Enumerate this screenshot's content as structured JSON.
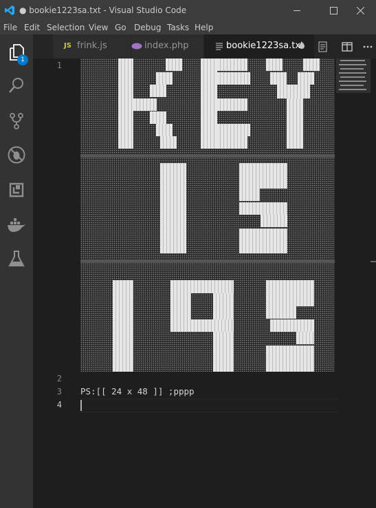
{
  "window": {
    "title": "● bookie1223sa.txt - Visual Studio Code",
    "controls": {
      "minimize": "minimize-icon",
      "maximize": "maximize-icon",
      "close": "close-icon"
    }
  },
  "menu": {
    "items": [
      "File",
      "Edit",
      "Selection",
      "View",
      "Go",
      "Debug",
      "Tasks",
      "Help"
    ]
  },
  "activity": {
    "items": [
      {
        "icon": "explorer-icon",
        "badge": "1"
      },
      {
        "icon": "search-icon"
      },
      {
        "icon": "source-control-icon"
      },
      {
        "icon": "debug-icon"
      },
      {
        "icon": "extensions-icon"
      },
      {
        "icon": "docker-icon"
      },
      {
        "icon": "flask-icon"
      }
    ]
  },
  "tabs": [
    {
      "prefix": "JS",
      "label": "frink.js",
      "active": false
    },
    {
      "prefix": "php",
      "label": "index.php",
      "active": false
    },
    {
      "prefix": "txt",
      "label": "bookie1223sa.txt",
      "active": true,
      "dirty": true
    }
  ],
  "editor": {
    "line_numbers": [
      "1",
      "2",
      "3",
      "4"
    ],
    "lines": {
      "line1": "",
      "line2": "",
      "line3": "PS:[[ 24 x 48 ]] ;pppp",
      "line4": ""
    },
    "ascii_art_letters": [
      "K",
      "E",
      "Y",
      "1",
      "5",
      "1",
      "9",
      "5"
    ]
  },
  "colors": {
    "titlebar": "#3c3c3c",
    "activitybar": "#333333",
    "editor_bg": "#1e1e1e",
    "accent": "#007acc"
  }
}
